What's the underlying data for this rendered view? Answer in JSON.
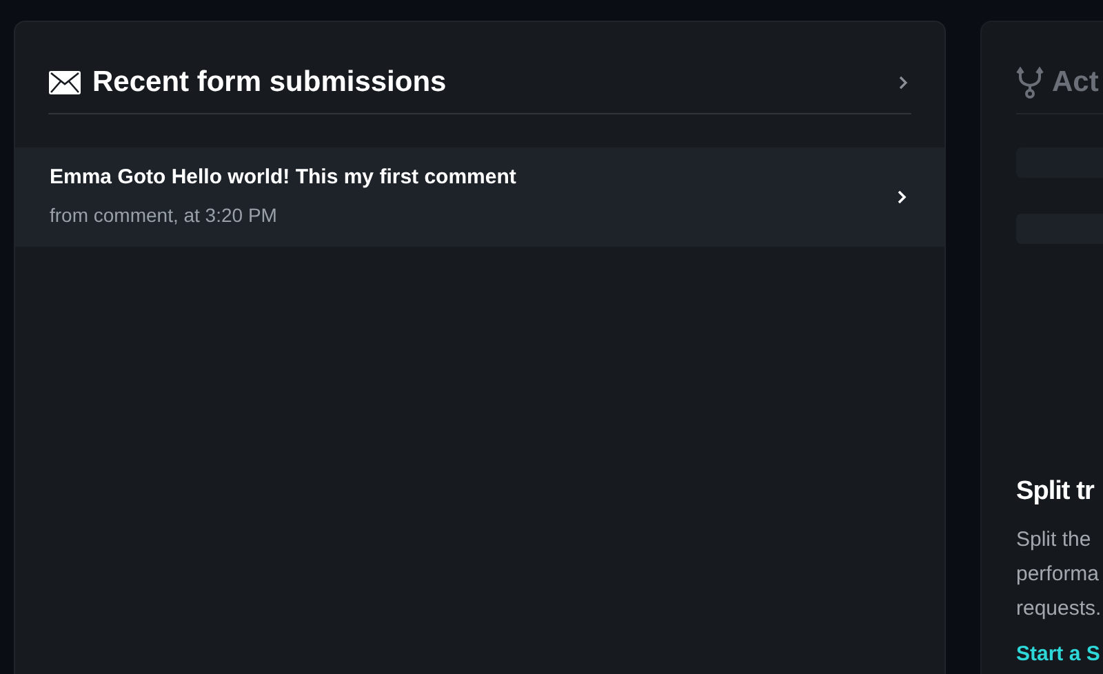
{
  "submissions_card": {
    "title": "Recent form submissions",
    "items": [
      {
        "title": "Emma Goto Hello world! This my first comment",
        "subtitle": "from comment, at 3:20 PM"
      }
    ]
  },
  "actions_card": {
    "title": "Act",
    "promo_title": "Split tr",
    "promo_lines": [
      "Split the",
      "performa",
      "requests."
    ],
    "link": "Start a S"
  }
}
